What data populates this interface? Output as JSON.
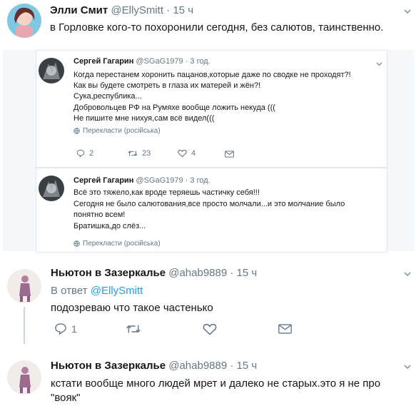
{
  "tweet_top": {
    "name": "Элли Смит",
    "handle": "@EllySmitt",
    "dot": "·",
    "time": "15 ч",
    "text": "в Горловке кого-то похоронили сегодня, без салютов, таинственно."
  },
  "embed1": {
    "name": "Сергей Гагарин",
    "handle": "@SGaG1979",
    "dot": "·",
    "time": "3 год.",
    "lines": [
      "Когда перестанем хоронить пацанов,которые даже по сводке не проходят?!",
      "Как вы будете смотреть в глаза их матерей и жён?!",
      "Сука,республика...",
      "Добровольцев РФ на Румяхе вообще ложить некуда (((",
      "Не пишите мне нихуя,сам всё видел((("
    ],
    "translate": "Перекласти (російська)",
    "reply_count": "2",
    "retweet_count": "23",
    "like_count": "4"
  },
  "embed2": {
    "name": "Сергей Гагарин",
    "handle": "@SGaG1979",
    "dot": "·",
    "time": "3 год.",
    "lines": [
      "Всё это тяжело,как вроде теряешь частичку себя!!!",
      "Сегодня не было салютования,все просто молчали...и это молчание было",
      "понятно всем!",
      "Братишка,до слёз..."
    ],
    "translate": "Перекласти (російська)"
  },
  "reply1": {
    "name": "Ньютон в Зазеркалье",
    "handle": "@ahab9889",
    "dot": "·",
    "time": "15 ч",
    "reply_to_prefix": "В ответ",
    "reply_to_handle": "@EllySmitt",
    "text": "подозреваю что такое частенько",
    "reply_count": "1"
  },
  "reply2": {
    "name": "Ньютон в Зазеркалье",
    "handle": "@ahab9889",
    "dot": "·",
    "time": "15 ч",
    "line1": "кстати вообще много людей мрет и далеко не старых.это я не про",
    "line2": "\"вояк\""
  },
  "colors": {
    "accent": "#1da1f2",
    "muted": "#657786",
    "text": "#14171a",
    "border": "#e1e8ed",
    "bg_gray": "#f5f8fa"
  }
}
